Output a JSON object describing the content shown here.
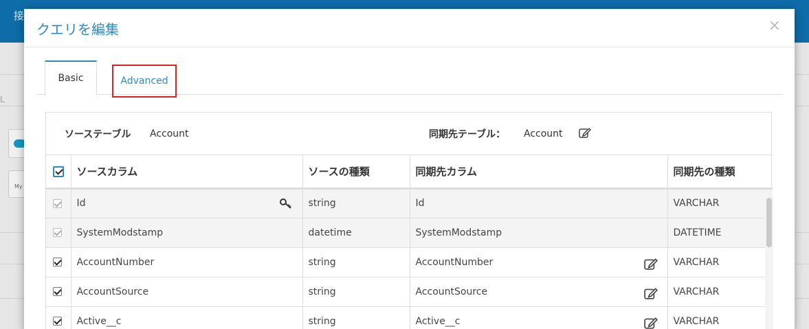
{
  "background": {
    "header_text": "接",
    "side_text": "L",
    "icon2_text": "My"
  },
  "modal": {
    "title": "クエリを編集",
    "close": "×"
  },
  "tabs": [
    {
      "label": "Basic",
      "active": true
    },
    {
      "label": "Advanced",
      "active": false,
      "highlighted": true
    }
  ],
  "panel": {
    "source_table_label": "ソーステーブル",
    "source_table_value": "Account",
    "target_table_label": "同期先テーブル：",
    "target_table_value": "Account"
  },
  "table": {
    "headers": [
      "ソースカラム",
      "ソースの種類",
      "同期先カラム",
      "同期先の種類"
    ],
    "rows": [
      {
        "checked": true,
        "disabled": true,
        "source": "Id",
        "key": true,
        "type": "string",
        "target": "Id",
        "editable": false,
        "target_type": "VARCHAR"
      },
      {
        "checked": true,
        "disabled": true,
        "source": "SystemModstamp",
        "key": false,
        "type": "datetime",
        "target": "SystemModstamp",
        "editable": false,
        "target_type": "DATETIME"
      },
      {
        "checked": true,
        "disabled": false,
        "source": "AccountNumber",
        "key": false,
        "type": "string",
        "target": "AccountNumber",
        "editable": true,
        "target_type": "VARCHAR"
      },
      {
        "checked": true,
        "disabled": false,
        "source": "AccountSource",
        "key": false,
        "type": "string",
        "target": "AccountSource",
        "editable": true,
        "target_type": "VARCHAR"
      },
      {
        "checked": true,
        "disabled": false,
        "source": "Active__c",
        "key": false,
        "type": "string",
        "target": "Active__c",
        "editable": true,
        "target_type": "VARCHAR"
      }
    ]
  },
  "colors": {
    "accent": "#2b8ac6",
    "header_bar": "#0e6ca8",
    "highlight": "#e02020"
  },
  "icons": [
    "close-icon",
    "edit-icon",
    "key-icon",
    "checkbox-icon"
  ]
}
